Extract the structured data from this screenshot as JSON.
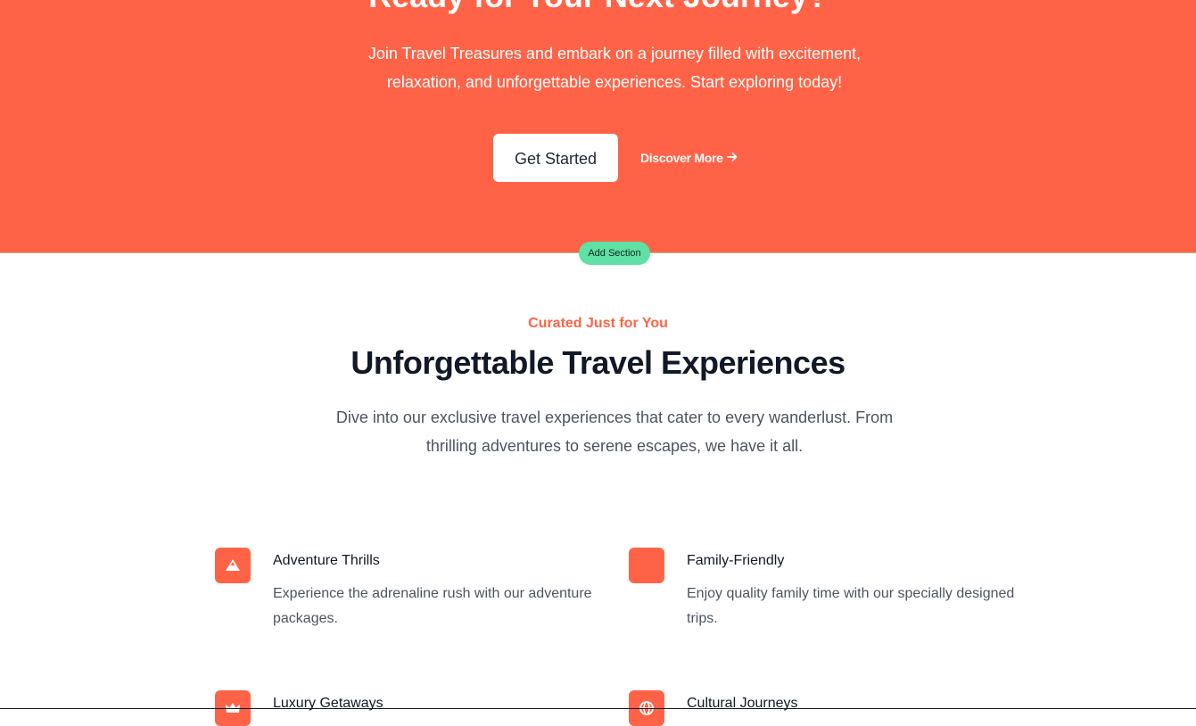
{
  "hero": {
    "title": "Ready for Your Next Journey?",
    "description": "Join Travel Treasures and embark on a journey filled with excitement, relaxation, and unforgettable experiences. Start exploring today!",
    "primary_button": "Get Started",
    "secondary_link": "Discover More",
    "background_color": "#ff6347"
  },
  "editor": {
    "add_section_label": "Add Section",
    "add_section_color": "#5fe0a4"
  },
  "experiences": {
    "eyebrow": "Curated Just for You",
    "title": "Unforgettable Travel Experiences",
    "description": "Dive into our exclusive travel experiences that cater to every wanderlust. From thrilling adventures to serene escapes, we have it all.",
    "features": [
      {
        "title": "Adventure Thrills",
        "description": "Experience the adrenaline rush with our adventure packages.",
        "icon": "mountain-icon"
      },
      {
        "title": "Family-Friendly",
        "description": "Enjoy quality family time with our specially designed trips.",
        "icon": "family-icon"
      },
      {
        "title": "Luxury Getaways",
        "description": "",
        "icon": "crown-icon"
      },
      {
        "title": "Cultural Journeys",
        "description": "",
        "icon": "globe-icon"
      }
    ]
  }
}
